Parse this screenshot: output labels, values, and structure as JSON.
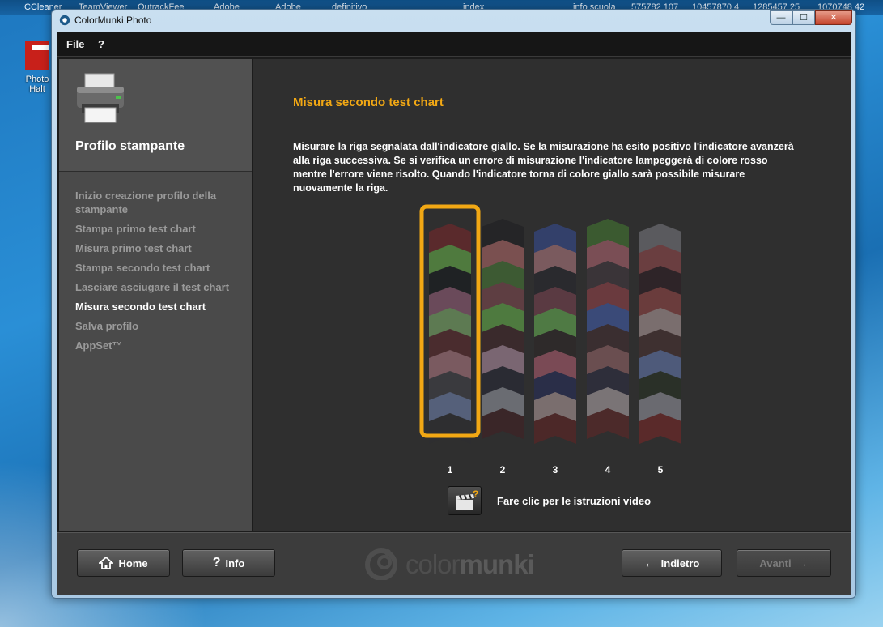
{
  "desktop": {
    "taskbar_items": [
      "CCleaner",
      "TeamViewer",
      "OutrackFee",
      "Adobe",
      "Adobe",
      "definitivo",
      "index",
      "info scuola",
      "575782 107",
      "10457870 4",
      "1285457 25",
      "1070748 42"
    ],
    "icon_label": "Photo Halt"
  },
  "window": {
    "title": "ColorMunki Photo",
    "controls": {
      "minimize": "—",
      "maximize": "☐",
      "close": "✕"
    }
  },
  "menu": {
    "file": "File",
    "help": "?"
  },
  "sidebar": {
    "title": "Profilo stampante",
    "steps": [
      {
        "label": "Inizio creazione profilo della stampante",
        "active": false
      },
      {
        "label": "Stampa primo test chart",
        "active": false
      },
      {
        "label": "Misura primo test chart",
        "active": false
      },
      {
        "label": "Stampa secondo test chart",
        "active": false
      },
      {
        "label": "Lasciare asciugare il test chart",
        "active": false
      },
      {
        "label": "Misura secondo test chart",
        "active": true
      },
      {
        "label": "Salva profilo",
        "active": false
      },
      {
        "label": "AppSet™",
        "active": false
      }
    ]
  },
  "main": {
    "title": "Misura secondo test chart",
    "description": "Misurare la riga segnalata dall'indicatore giallo.  Se la misurazione ha esito positivo l'indicatore avanzerà alla riga successiva.  Se si verifica un errore di misurazione l'indicatore lampeggerà di colore rosso mentre l'errore viene risolto.  Quando l'indicatore torna di colore giallo sarà possibile misurare nuovamente la riga.",
    "selected_row": 1,
    "indicator_color": "#f2a814",
    "rows": [
      {
        "label": "1",
        "patches": [
          "#5a2a2c",
          "#4f7a3e",
          "#1f2224",
          "#6a4a5a",
          "#5d7a52",
          "#4a2c2e",
          "#7a5a60",
          "#3a3a3e",
          "#55607a",
          "#2e2e30"
        ]
      },
      {
        "label": "2",
        "patches": [
          "#252527",
          "#7a5050",
          "#3d5a33",
          "#5e3e42",
          "#4e7a3f",
          "#3a2a2c",
          "#7a6672",
          "#2a2b33",
          "#6a6c72",
          "#3a2628"
        ]
      },
      {
        "label": "3",
        "patches": [
          "#33406a",
          "#7a5a5e",
          "#2a2a2e",
          "#5a3a42",
          "#4f7a44",
          "#2e2a2a",
          "#7a4a55",
          "#2a2e48",
          "#7a6e6e",
          "#4c2828"
        ]
      },
      {
        "label": "4",
        "patches": [
          "#3b5a30",
          "#7a4e55",
          "#3a3438",
          "#6a3a3e",
          "#3a4a78",
          "#3a2e30",
          "#6a4e50",
          "#2e2e3a",
          "#7a7476",
          "#4c2a2a"
        ]
      },
      {
        "label": "5",
        "patches": [
          "#5a5a5e",
          "#6a3e40",
          "#2e2428",
          "#6a3c3c",
          "#7a6e6e",
          "#3e3030",
          "#4e5a7a",
          "#2a3028",
          "#6a6a70",
          "#5a2a2a"
        ]
      }
    ],
    "video_text": "Fare clic per le istruzioni video"
  },
  "footer": {
    "home_label": "Home",
    "info_label": "Info",
    "back_label": "Indietro",
    "next_label": "Avanti",
    "logo": {
      "prefix": "color",
      "suffix": "munki"
    }
  }
}
